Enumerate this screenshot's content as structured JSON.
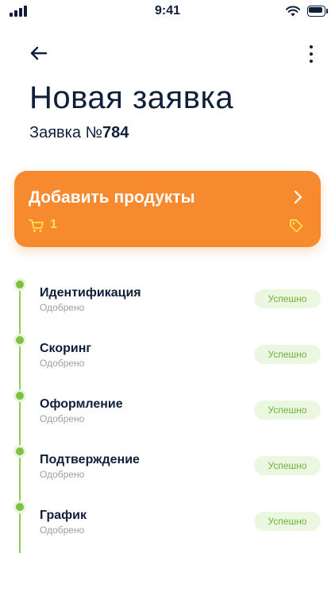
{
  "status_bar": {
    "time": "9:41"
  },
  "header": {
    "title": "Новая заявка",
    "order_prefix": "Заявка №",
    "order_number": "784"
  },
  "products_card": {
    "title": "Добавить продукты",
    "cart_count": "1",
    "accent_color": "#f7892e"
  },
  "steps": [
    {
      "title": "Идентификация",
      "subtitle": "Одобрено",
      "status": "Успешно"
    },
    {
      "title": "Скоринг",
      "subtitle": "Одобрено",
      "status": "Успешно"
    },
    {
      "title": "Оформление",
      "subtitle": "Одобрено",
      "status": "Успешно"
    },
    {
      "title": "Подтверждение",
      "subtitle": "Одобрено",
      "status": "Успешно"
    },
    {
      "title": "График",
      "subtitle": "Одобрено",
      "status": "Успешно"
    }
  ],
  "icons": [
    "signal-icon",
    "wifi-icon",
    "battery-icon",
    "back-arrow-icon",
    "more-vertical-icon",
    "chevron-right-icon",
    "cart-icon",
    "tag-icon"
  ]
}
